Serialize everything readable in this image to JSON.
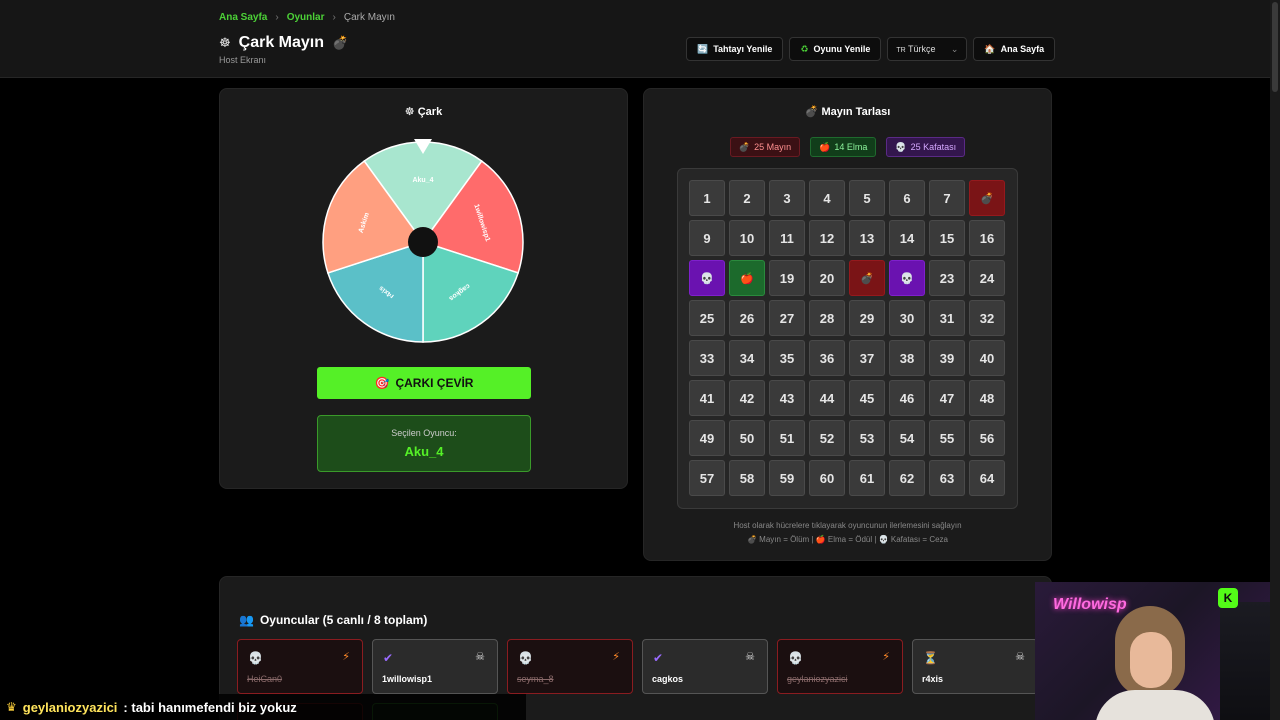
{
  "breadcrumb": {
    "home": "Ana Sayfa",
    "games": "Oyunlar",
    "current": "Çark Mayın"
  },
  "header": {
    "title": "Çark Mayın",
    "title_icon_left": "wheel-icon",
    "title_icon_right": "bomb-icon",
    "subtitle": "Host Ekranı",
    "buttons": {
      "reset_board": "Tahtayı Yenile",
      "reset_game": "Oyunu Yenile",
      "language": "Türkçe",
      "language_flag": "TR",
      "home": "Ana Sayfa"
    }
  },
  "wheel_panel": {
    "title": "Çark",
    "segments": [
      {
        "label": "Aku_4",
        "color": "#a8e6cf"
      },
      {
        "label": "1willowisp1",
        "color": "#ff6b6b"
      },
      {
        "label": "cagkos",
        "color": "#5fd3bc"
      },
      {
        "label": "r4xis",
        "color": "#5bc0c8"
      },
      {
        "label": "Askim",
        "color": "#ff9f80"
      }
    ],
    "spin_button": "ÇARKI ÇEVİR",
    "selected_label": "Seçilen Oyuncu:",
    "selected_value": "Aku_4"
  },
  "mine_panel": {
    "title": "Mayın Tarlası",
    "badges": {
      "mines": "25 Mayın",
      "apples": "14 Elma",
      "skulls": "25 Kafatası"
    },
    "cells": [
      {
        "n": "1",
        "s": ""
      },
      {
        "n": "2",
        "s": ""
      },
      {
        "n": "3",
        "s": ""
      },
      {
        "n": "4",
        "s": ""
      },
      {
        "n": "5",
        "s": ""
      },
      {
        "n": "6",
        "s": ""
      },
      {
        "n": "7",
        "s": ""
      },
      {
        "n": "",
        "s": "mine"
      },
      {
        "n": "9",
        "s": ""
      },
      {
        "n": "10",
        "s": ""
      },
      {
        "n": "11",
        "s": ""
      },
      {
        "n": "12",
        "s": ""
      },
      {
        "n": "13",
        "s": ""
      },
      {
        "n": "14",
        "s": ""
      },
      {
        "n": "15",
        "s": ""
      },
      {
        "n": "16",
        "s": ""
      },
      {
        "n": "",
        "s": "skull"
      },
      {
        "n": "",
        "s": "apple"
      },
      {
        "n": "19",
        "s": ""
      },
      {
        "n": "20",
        "s": ""
      },
      {
        "n": "",
        "s": "mine"
      },
      {
        "n": "",
        "s": "skull"
      },
      {
        "n": "23",
        "s": ""
      },
      {
        "n": "24",
        "s": ""
      },
      {
        "n": "25",
        "s": ""
      },
      {
        "n": "26",
        "s": ""
      },
      {
        "n": "27",
        "s": ""
      },
      {
        "n": "28",
        "s": ""
      },
      {
        "n": "29",
        "s": ""
      },
      {
        "n": "30",
        "s": ""
      },
      {
        "n": "31",
        "s": ""
      },
      {
        "n": "32",
        "s": ""
      },
      {
        "n": "33",
        "s": ""
      },
      {
        "n": "34",
        "s": ""
      },
      {
        "n": "35",
        "s": ""
      },
      {
        "n": "36",
        "s": ""
      },
      {
        "n": "37",
        "s": ""
      },
      {
        "n": "38",
        "s": ""
      },
      {
        "n": "39",
        "s": ""
      },
      {
        "n": "40",
        "s": ""
      },
      {
        "n": "41",
        "s": ""
      },
      {
        "n": "42",
        "s": ""
      },
      {
        "n": "43",
        "s": ""
      },
      {
        "n": "44",
        "s": ""
      },
      {
        "n": "45",
        "s": ""
      },
      {
        "n": "46",
        "s": ""
      },
      {
        "n": "47",
        "s": ""
      },
      {
        "n": "48",
        "s": ""
      },
      {
        "n": "49",
        "s": ""
      },
      {
        "n": "50",
        "s": ""
      },
      {
        "n": "51",
        "s": ""
      },
      {
        "n": "52",
        "s": ""
      },
      {
        "n": "53",
        "s": ""
      },
      {
        "n": "54",
        "s": ""
      },
      {
        "n": "55",
        "s": ""
      },
      {
        "n": "56",
        "s": ""
      },
      {
        "n": "57",
        "s": ""
      },
      {
        "n": "58",
        "s": ""
      },
      {
        "n": "59",
        "s": ""
      },
      {
        "n": "60",
        "s": ""
      },
      {
        "n": "61",
        "s": ""
      },
      {
        "n": "62",
        "s": ""
      },
      {
        "n": "63",
        "s": ""
      },
      {
        "n": "64",
        "s": ""
      }
    ],
    "footnote_line1": "Host olarak hücrelere tıklayarak oyuncunun ilerlemesini sağlayın",
    "footnote_line2": "💣 Mayın = Ölüm | 🍎 Elma = Ödül | 💀 Kafatası = Ceza"
  },
  "players_panel": {
    "title": "Oyuncular (5 canlı / 8 toplam)",
    "players": [
      {
        "name": "HeiCan0",
        "status": "dead",
        "icon": "💀",
        "action": "⚡"
      },
      {
        "name": "1willowisp1",
        "status": "alive",
        "icon": "✔",
        "action": "☠"
      },
      {
        "name": "seyma_8",
        "status": "dead",
        "icon": "💀",
        "action": "⚡"
      },
      {
        "name": "cagkos",
        "status": "alive",
        "icon": "✔",
        "action": "☠"
      },
      {
        "name": "geylaniozyazici",
        "status": "dead",
        "icon": "💀",
        "action": "⚡"
      },
      {
        "name": "r4xis",
        "status": "alive",
        "icon": "⏳",
        "action": "☠"
      }
    ]
  },
  "chat": {
    "user": "geylaniozyazici",
    "message": ": tabi hanımefendi biz yokuz"
  },
  "webcam": {
    "sign": "Willowisp",
    "logo": "K"
  },
  "colors": {
    "accent": "#55f027",
    "mine": "#7a1416",
    "apple": "#1c6a2c",
    "skull": "#6a12b0"
  }
}
